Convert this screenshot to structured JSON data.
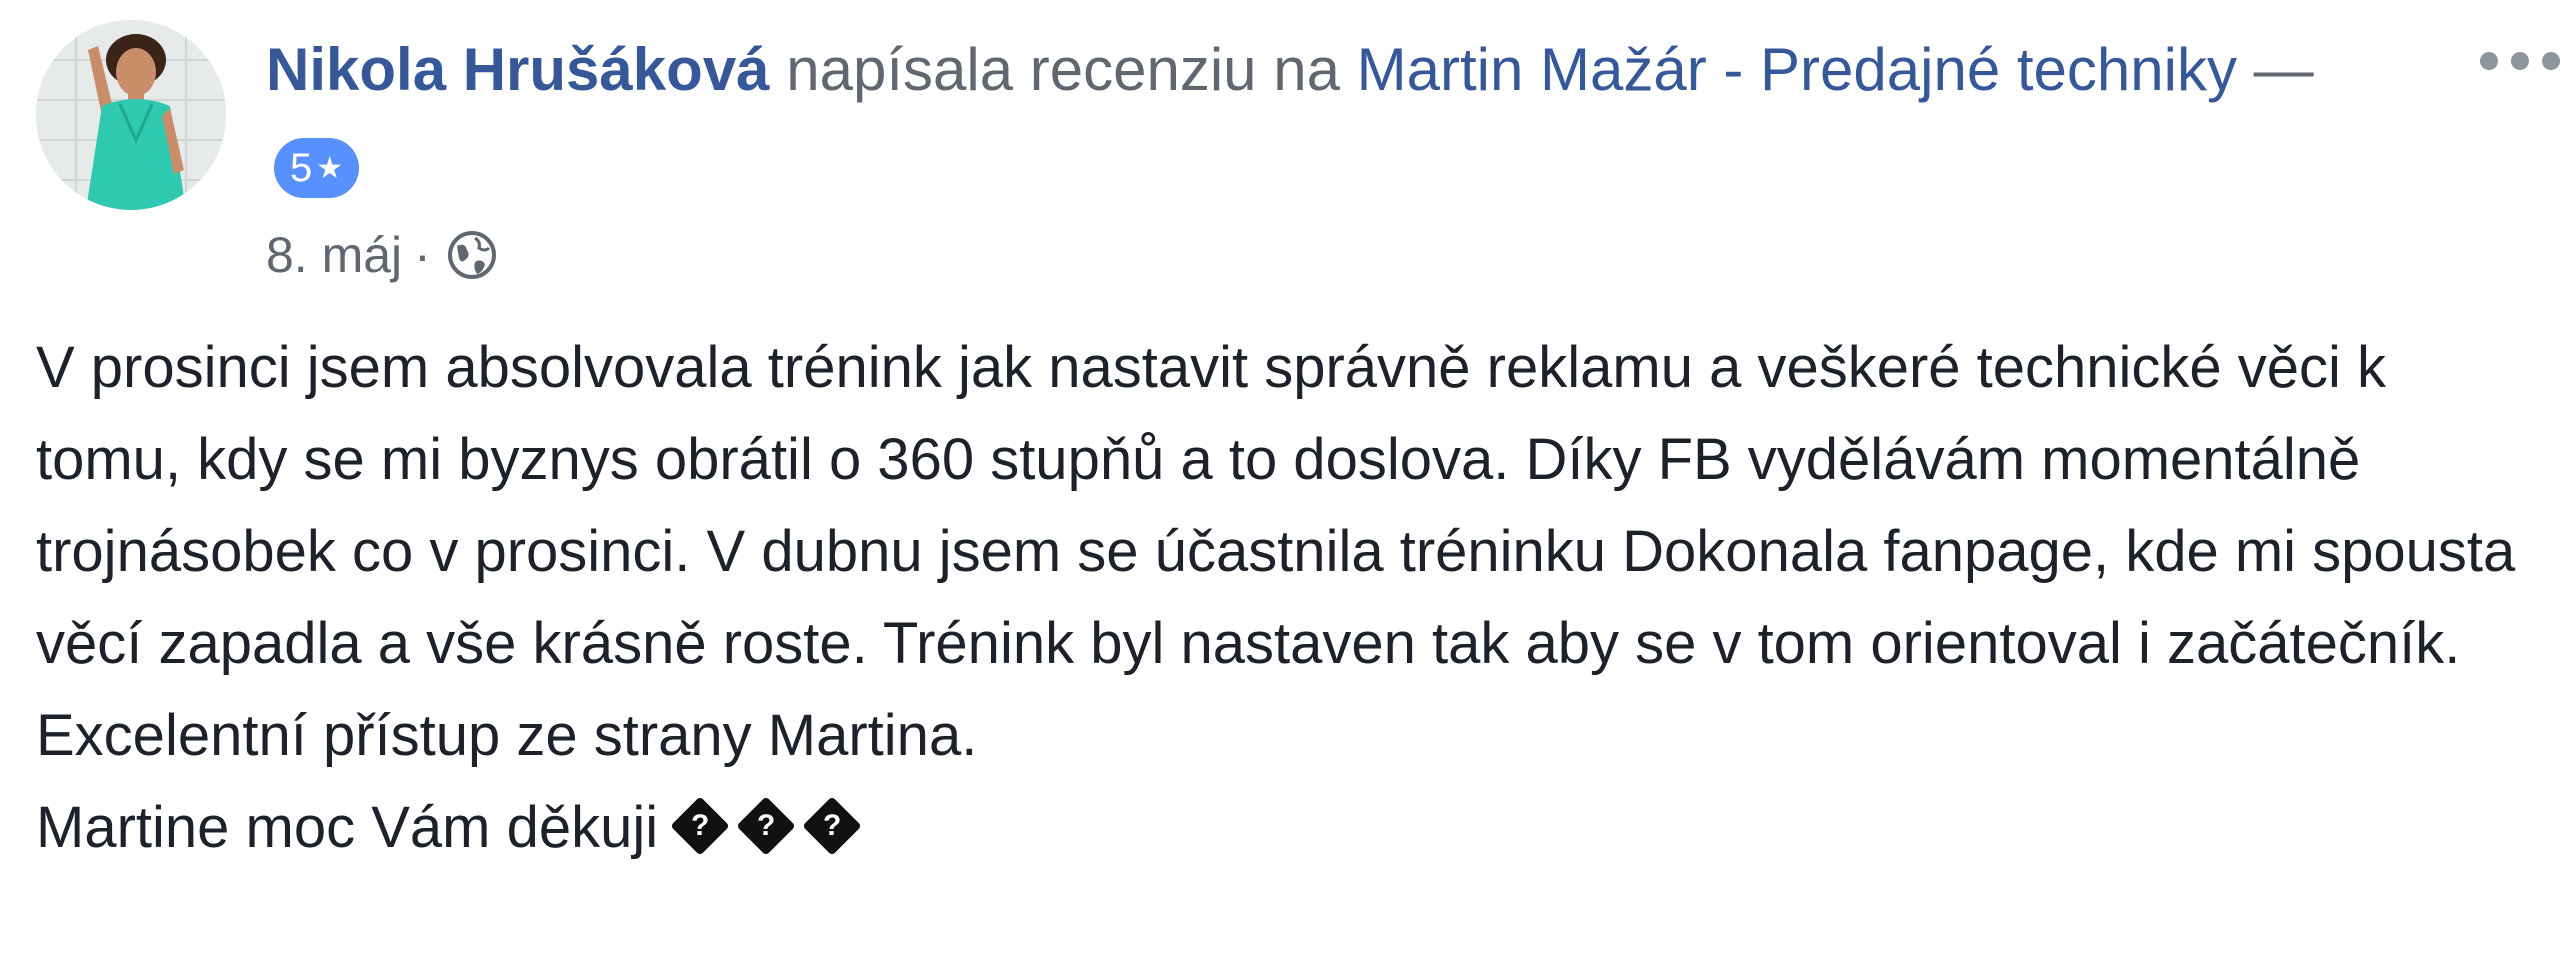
{
  "review": {
    "author": "Nikola Hrušáková",
    "action": "napísala recenziu na",
    "page_name": "Martin Mažár - Predajné techniky",
    "dash": "—",
    "rating": {
      "value": "5",
      "icon": "star-icon",
      "star_glyph": "★",
      "badge_color": "#5890ff"
    },
    "date": "8. máj",
    "separator": "·",
    "privacy_icon": "globe-icon",
    "more_icon": "more-dots-icon",
    "body_paragraph": "V prosinci jsem absolvovala trénink jak nastavit správně reklamu a veškeré technické věci k tomu, kdy se mi byznys obrátil o 360 stupňů a to doslova. Díky FB vydělávám momentálně trojnásobek co v prosinci. V dubnu jsem se účastnila tréninku Dokonala fanpage, kde mi spousta věcí zapadla a vše krásně roste. Trénink byl nastaven tak aby se v tom orientoval i začátečník. Excelentní přístup ze strany Martina.",
    "closing_line": "Martine moc Vám děkuji",
    "emoji_placeholders": [
      "?",
      "?",
      "?"
    ]
  },
  "colors": {
    "link": "#365899",
    "meta": "#616770",
    "text": "#1d2129"
  }
}
